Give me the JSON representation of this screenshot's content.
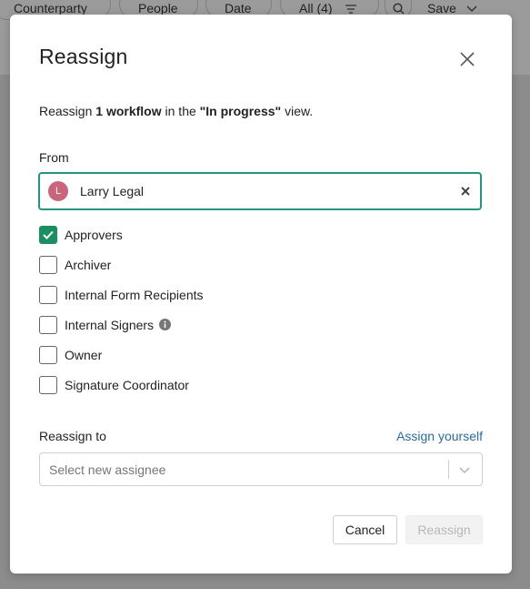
{
  "background": {
    "toolbar": {
      "filters": [
        {
          "label": "Counterparty"
        },
        {
          "label": "People"
        },
        {
          "label": "Date"
        },
        {
          "label": "All (4)"
        }
      ],
      "save_label": "Save"
    }
  },
  "modal": {
    "title": "Reassign",
    "description": {
      "prefix": "Reassign ",
      "count_text": "1 workflow",
      "middle": " in the ",
      "view_name": "\"In progress\"",
      "suffix": " view."
    },
    "from": {
      "label": "From",
      "avatar_initial": "L",
      "avatar_color": "#c9647a",
      "value": "Larry Legal",
      "accent_color": "#23967d"
    },
    "roles": [
      {
        "label": "Approvers",
        "checked": true
      },
      {
        "label": "Archiver",
        "checked": false
      },
      {
        "label": "Internal Form Recipients",
        "checked": false
      },
      {
        "label": "Internal Signers",
        "checked": false,
        "has_info_icon": true
      },
      {
        "label": "Owner",
        "checked": false
      },
      {
        "label": "Signature Coordinator",
        "checked": false
      }
    ],
    "reassign_to": {
      "label": "Reassign to",
      "assign_yourself_label": "Assign yourself",
      "placeholder": "Select new assignee"
    },
    "buttons": {
      "cancel_label": "Cancel",
      "reassign_label": "Reassign"
    }
  }
}
